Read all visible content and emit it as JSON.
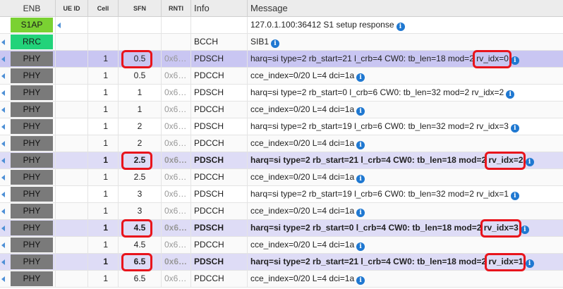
{
  "columns": {
    "enb": "ENB",
    "ue_id": "UE ID",
    "cell": "Cell",
    "sfn": "SFN",
    "rnti": "RNTI",
    "info": "Info",
    "message": "Message"
  },
  "rows": [
    {
      "layer": "S1AP",
      "layer_color": "#7ad132",
      "arrow": false,
      "ue_arrow": true,
      "cell": "",
      "sfn": "",
      "rnti": "",
      "info": "",
      "message": "127.0.1.100:36412 S1 setup response",
      "icon": "info-icon"
    },
    {
      "layer": "RRC",
      "layer_color": "#22d37a",
      "arrow": true,
      "cell": "",
      "sfn": "",
      "rnti": "",
      "info": "BCCH",
      "message": "SIB1",
      "icon": "info-icon"
    },
    {
      "layer": "PHY",
      "arrow": true,
      "cell": "1",
      "sfn": "0.5",
      "rnti": "0x6…",
      "info": "PDSCH",
      "message": "harq=si type=2 rb_start=21 l_crb=4 CW0: tb_len=18 mod=2 rv_idx=0",
      "icon": "info-icon",
      "highlight": true
    },
    {
      "layer": "PHY",
      "arrow": true,
      "cell": "1",
      "sfn": "0.5",
      "rnti": "0x6…",
      "info": "PDCCH",
      "message": "cce_index=0/20 L=4 dci=1a",
      "icon": "info-icon"
    },
    {
      "layer": "PHY",
      "arrow": true,
      "cell": "1",
      "sfn": "1",
      "rnti": "0x6…",
      "info": "PDSCH",
      "message": "harq=si type=2 rb_start=0 l_crb=6 CW0: tb_len=32 mod=2 rv_idx=2",
      "icon": "info-icon"
    },
    {
      "layer": "PHY",
      "arrow": true,
      "cell": "1",
      "sfn": "1",
      "rnti": "0x6…",
      "info": "PDCCH",
      "message": "cce_index=0/20 L=4 dci=1a",
      "icon": "info-icon"
    },
    {
      "layer": "PHY",
      "arrow": true,
      "cell": "1",
      "sfn": "2",
      "rnti": "0x6…",
      "info": "PDSCH",
      "message": "harq=si type=2 rb_start=19 l_crb=6 CW0: tb_len=32 mod=2 rv_idx=3",
      "icon": "info-icon"
    },
    {
      "layer": "PHY",
      "arrow": true,
      "cell": "1",
      "sfn": "2",
      "rnti": "0x6…",
      "info": "PDCCH",
      "message": "cce_index=0/20 L=4 dci=1a",
      "icon": "info-icon"
    },
    {
      "layer": "PHY",
      "arrow": true,
      "cell": "1",
      "sfn": "2.5",
      "rnti": "0x6…",
      "info": "PDSCH",
      "message": "harq=si type=2 rb_start=21 l_crb=4 CW0: tb_len=18 mod=2 rv_idx=2",
      "icon": "info-icon",
      "highlight": true
    },
    {
      "layer": "PHY",
      "arrow": true,
      "cell": "1",
      "sfn": "2.5",
      "rnti": "0x6…",
      "info": "PDCCH",
      "message": "cce_index=0/20 L=4 dci=1a",
      "icon": "info-icon"
    },
    {
      "layer": "PHY",
      "arrow": true,
      "cell": "1",
      "sfn": "3",
      "rnti": "0x6…",
      "info": "PDSCH",
      "message": "harq=si type=2 rb_start=19 l_crb=6 CW0: tb_len=32 mod=2 rv_idx=1",
      "icon": "info-icon"
    },
    {
      "layer": "PHY",
      "arrow": true,
      "cell": "1",
      "sfn": "3",
      "rnti": "0x6…",
      "info": "PDCCH",
      "message": "cce_index=0/20 L=4 dci=1a",
      "icon": "info-icon"
    },
    {
      "layer": "PHY",
      "arrow": true,
      "cell": "1",
      "sfn": "4.5",
      "rnti": "0x6…",
      "info": "PDSCH",
      "message": "harq=si type=2 rb_start=0 l_crb=4 CW0: tb_len=18 mod=2 rv_idx=3",
      "icon": "info-icon",
      "highlight": true
    },
    {
      "layer": "PHY",
      "arrow": true,
      "cell": "1",
      "sfn": "4.5",
      "rnti": "0x6…",
      "info": "PDCCH",
      "message": "cce_index=0/20 L=4 dci=1a",
      "icon": "info-icon"
    },
    {
      "layer": "PHY",
      "arrow": true,
      "cell": "1",
      "sfn": "6.5",
      "rnti": "0x6…",
      "info": "PDSCH",
      "message": "harq=si type=2 rb_start=21 l_crb=4 CW0: tb_len=18 mod=2 rv_idx=1",
      "icon": "info-icon",
      "highlight": true
    },
    {
      "layer": "PHY",
      "arrow": true,
      "cell": "1",
      "sfn": "6.5",
      "rnti": "0x6…",
      "info": "PDCCH",
      "message": "cce_index=0/20 L=4 dci=1a",
      "icon": "info-icon"
    }
  ],
  "colors": {
    "highlight_row": "#dedcf6",
    "hover_row": "#c9c6f2",
    "annotation_red": "#e8141c",
    "phy_layer": "#7a7a7a",
    "s1ap_layer": "#7ad132",
    "rrc_layer": "#22d37a",
    "info_icon": "#1f78d1"
  }
}
